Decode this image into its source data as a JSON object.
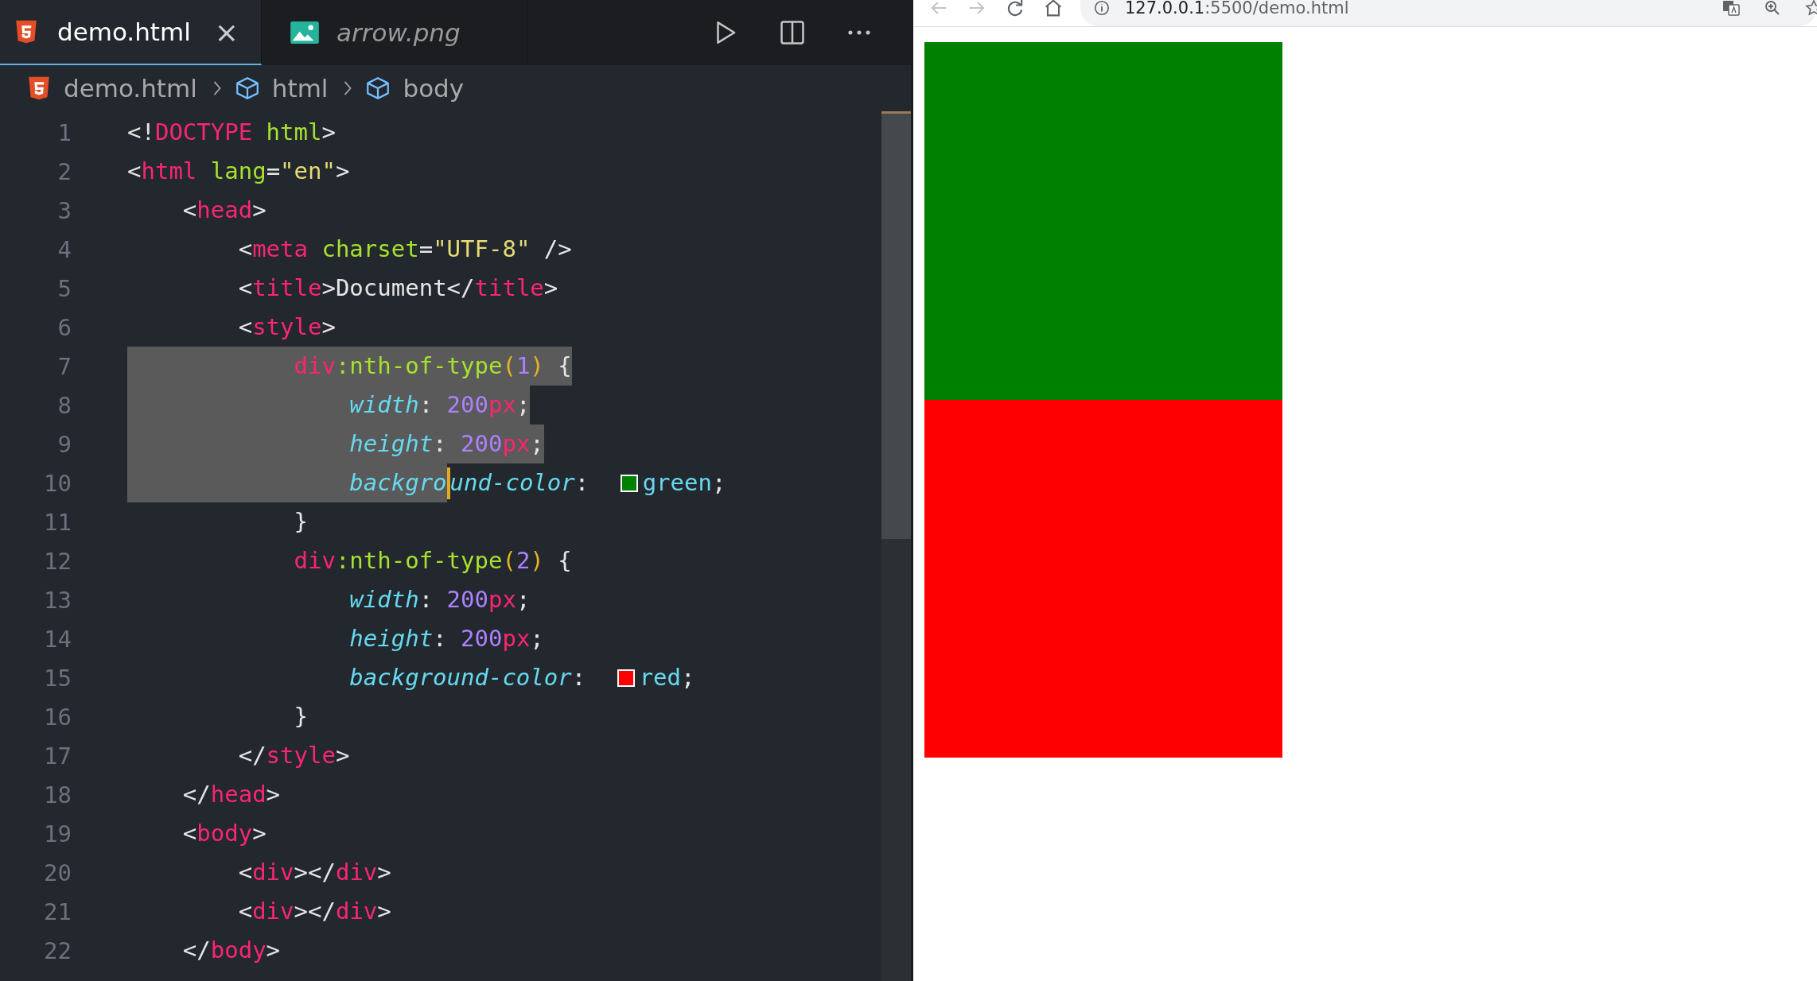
{
  "editor": {
    "tabs": [
      {
        "label": "demo.html",
        "kind": "html",
        "selected": true,
        "preview": false,
        "close": "×"
      },
      {
        "label": "arrow.png",
        "kind": "image",
        "selected": false,
        "preview": true
      }
    ],
    "breadcrumb": [
      {
        "label": "demo.html",
        "kind": "html"
      },
      {
        "label": "html",
        "kind": "element"
      },
      {
        "label": "body",
        "kind": "element"
      }
    ],
    "lines": [
      {
        "number": "1",
        "selected": false,
        "tokens": [
          {
            "kind": "punct",
            "text": "<!"
          },
          {
            "kind": "tag",
            "text": "DOCTYPE"
          },
          {
            "kind": "attr",
            "text": " html"
          },
          {
            "kind": "punct",
            "text": ">"
          }
        ]
      },
      {
        "number": "2",
        "selected": false,
        "tokens": [
          {
            "kind": "punct",
            "text": "<"
          },
          {
            "kind": "tag",
            "text": "html"
          },
          {
            "kind": "attr",
            "text": " lang"
          },
          {
            "kind": "punct",
            "text": "="
          },
          {
            "kind": "string",
            "text": "\"en\""
          },
          {
            "kind": "punct",
            "text": ">"
          }
        ]
      },
      {
        "number": "3",
        "selected": false,
        "tokens": [
          {
            "kind": "punct",
            "text": "    <"
          },
          {
            "kind": "tag",
            "text": "head"
          },
          {
            "kind": "punct",
            "text": ">"
          }
        ]
      },
      {
        "number": "4",
        "selected": false,
        "tokens": [
          {
            "kind": "punct",
            "text": "        <"
          },
          {
            "kind": "tag",
            "text": "meta"
          },
          {
            "kind": "attr",
            "text": " charset"
          },
          {
            "kind": "punct",
            "text": "="
          },
          {
            "kind": "string",
            "text": "\"UTF-8\""
          },
          {
            "kind": "punct",
            "text": " />"
          }
        ]
      },
      {
        "number": "5",
        "selected": false,
        "tokens": [
          {
            "kind": "punct",
            "text": "        <"
          },
          {
            "kind": "tag",
            "text": "title"
          },
          {
            "kind": "punct",
            "text": ">Document</"
          },
          {
            "kind": "tag",
            "text": "title"
          },
          {
            "kind": "punct",
            "text": ">"
          }
        ]
      },
      {
        "number": "6",
        "selected": false,
        "tokens": [
          {
            "kind": "punct",
            "text": "        <"
          },
          {
            "kind": "tag",
            "text": "style"
          },
          {
            "kind": "punct",
            "text": ">"
          }
        ]
      },
      {
        "number": "7",
        "selected": true,
        "tokens": [
          {
            "kind": "tag",
            "text": "            div"
          },
          {
            "kind": "attr",
            "text": ":nth-of-type"
          },
          {
            "kind": "paren",
            "text": "("
          },
          {
            "kind": "num",
            "text": "1"
          },
          {
            "kind": "paren",
            "text": ")"
          },
          {
            "kind": "punct",
            "text": " {"
          }
        ]
      },
      {
        "number": "8",
        "selected": true,
        "tokens": [
          {
            "kind": "prop",
            "text": "                width"
          },
          {
            "kind": "punct",
            "text": ": "
          },
          {
            "kind": "num",
            "text": "200"
          },
          {
            "kind": "unit",
            "text": "px"
          },
          {
            "kind": "punct",
            "text": ";"
          }
        ]
      },
      {
        "number": "9",
        "selected": true,
        "tokens": [
          {
            "kind": "prop",
            "text": "                height"
          },
          {
            "kind": "punct",
            "text": ": "
          },
          {
            "kind": "num",
            "text": "200"
          },
          {
            "kind": "unit",
            "text": "px"
          },
          {
            "kind": "punct",
            "text": ";"
          }
        ]
      },
      {
        "number": "10",
        "selected": true,
        "tokens": [
          {
            "kind": "prop",
            "text": "                backgro"
          },
          {
            "kind": "cursor"
          },
          {
            "kind": "prop",
            "text": "und-color"
          },
          {
            "kind": "punct",
            "text": ": "
          },
          {
            "kind": "swatch",
            "color": "#008000"
          },
          {
            "kind": "value",
            "text": "green"
          },
          {
            "kind": "punct",
            "text": ";"
          }
        ]
      },
      {
        "number": "11",
        "selected": false,
        "tokens": [
          {
            "kind": "punct",
            "text": "            }"
          }
        ]
      },
      {
        "number": "12",
        "selected": false,
        "tokens": [
          {
            "kind": "tag",
            "text": "            div"
          },
          {
            "kind": "attr",
            "text": ":nth-of-type"
          },
          {
            "kind": "paren",
            "text": "("
          },
          {
            "kind": "num",
            "text": "2"
          },
          {
            "kind": "paren",
            "text": ")"
          },
          {
            "kind": "punct",
            "text": " {"
          }
        ]
      },
      {
        "number": "13",
        "selected": false,
        "tokens": [
          {
            "kind": "prop",
            "text": "                width"
          },
          {
            "kind": "punct",
            "text": ": "
          },
          {
            "kind": "num",
            "text": "200"
          },
          {
            "kind": "unit",
            "text": "px"
          },
          {
            "kind": "punct",
            "text": ";"
          }
        ]
      },
      {
        "number": "14",
        "selected": false,
        "tokens": [
          {
            "kind": "prop",
            "text": "                height"
          },
          {
            "kind": "punct",
            "text": ": "
          },
          {
            "kind": "num",
            "text": "200"
          },
          {
            "kind": "unit",
            "text": "px"
          },
          {
            "kind": "punct",
            "text": ";"
          }
        ]
      },
      {
        "number": "15",
        "selected": false,
        "tokens": [
          {
            "kind": "prop",
            "text": "                background-color"
          },
          {
            "kind": "punct",
            "text": ": "
          },
          {
            "kind": "swatch",
            "color": "#ff0000"
          },
          {
            "kind": "value",
            "text": "red"
          },
          {
            "kind": "punct",
            "text": ";"
          }
        ]
      },
      {
        "number": "16",
        "selected": false,
        "tokens": [
          {
            "kind": "punct",
            "text": "            }"
          }
        ]
      },
      {
        "number": "17",
        "selected": false,
        "tokens": [
          {
            "kind": "punct",
            "text": "        </"
          },
          {
            "kind": "tag",
            "text": "style"
          },
          {
            "kind": "punct",
            "text": ">"
          }
        ]
      },
      {
        "number": "18",
        "selected": false,
        "tokens": [
          {
            "kind": "punct",
            "text": "    </"
          },
          {
            "kind": "tag",
            "text": "head"
          },
          {
            "kind": "punct",
            "text": ">"
          }
        ]
      },
      {
        "number": "19",
        "selected": false,
        "tokens": [
          {
            "kind": "punct",
            "text": "    <"
          },
          {
            "kind": "tag",
            "text": "body"
          },
          {
            "kind": "punct",
            "text": ">"
          }
        ]
      },
      {
        "number": "20",
        "selected": false,
        "tokens": [
          {
            "kind": "punct",
            "text": "        <"
          },
          {
            "kind": "tag",
            "text": "div"
          },
          {
            "kind": "punct",
            "text": "></"
          },
          {
            "kind": "tag",
            "text": "div"
          },
          {
            "kind": "punct",
            "text": ">"
          }
        ]
      },
      {
        "number": "21",
        "selected": false,
        "tokens": [
          {
            "kind": "punct",
            "text": "        <"
          },
          {
            "kind": "tag",
            "text": "div"
          },
          {
            "kind": "punct",
            "text": "></"
          },
          {
            "kind": "tag",
            "text": "div"
          },
          {
            "kind": "punct",
            "text": ">"
          }
        ]
      },
      {
        "number": "22",
        "selected": false,
        "tokens": [
          {
            "kind": "punct",
            "text": "    </"
          },
          {
            "kind": "tag",
            "text": "body"
          },
          {
            "kind": "punct",
            "text": ">"
          }
        ]
      }
    ]
  },
  "browser": {
    "address_host": "127.0.0.1",
    "address_path": ":5500/demo.html",
    "page_boxes": [
      {
        "color": "#008000"
      },
      {
        "color": "#ff0000"
      }
    ]
  }
}
